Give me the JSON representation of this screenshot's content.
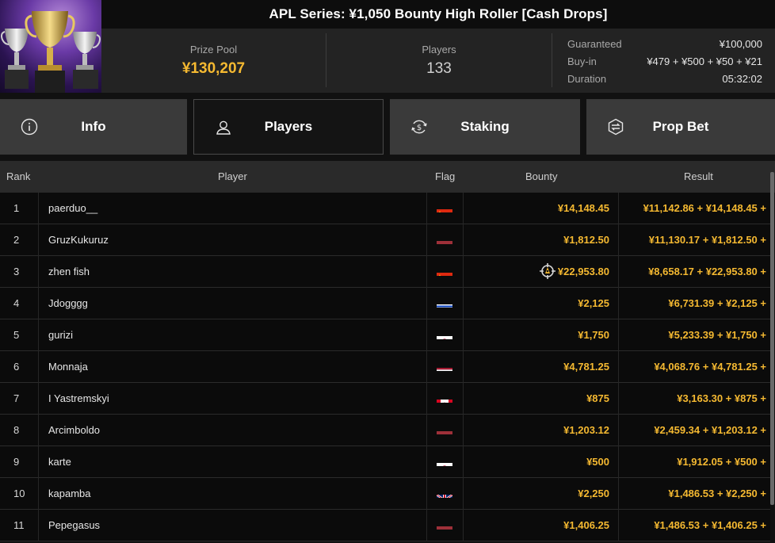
{
  "header": {
    "title": "APL Series: ¥1,050 Bounty High Roller [Cash Drops]",
    "prize_pool_label": "Prize Pool",
    "prize_pool_value": "¥130,207",
    "players_label": "Players",
    "players_value": "133",
    "details": [
      {
        "key": "Guaranteed",
        "value": "¥100,000"
      },
      {
        "key": "Buy-in",
        "value": "¥479 + ¥500 + ¥50 + ¥21"
      },
      {
        "key": "Duration",
        "value": "05:32:02"
      }
    ]
  },
  "tabs": [
    {
      "label": "Info",
      "icon": "info-icon",
      "active": false
    },
    {
      "label": "Players",
      "icon": "user-icon",
      "active": true
    },
    {
      "label": "Staking",
      "icon": "dollar-cycle-icon",
      "active": false
    },
    {
      "label": "Prop Bet",
      "icon": "prop-bet-icon",
      "active": false
    }
  ],
  "table": {
    "columns": {
      "rank": "Rank",
      "player": "Player",
      "flag": "Flag",
      "bounty": "Bounty",
      "result": "Result"
    },
    "rows": [
      {
        "rank": "1",
        "player": "paerduo__",
        "flag": "cn",
        "bounty": "¥14,148.45",
        "result": "¥11,142.86 + ¥14,148.45 +"
      },
      {
        "rank": "2",
        "player": "GruzKukuruz",
        "flag": "lv",
        "bounty": "¥1,812.50",
        "result": "¥11,130.17 + ¥1,812.50 +"
      },
      {
        "rank": "3",
        "player": "zhen fish",
        "flag": "cn",
        "bounty": "¥22,953.80",
        "result": "¥8,658.17 + ¥22,953.80 +",
        "bounty_icon": "target-icon"
      },
      {
        "rank": "4",
        "player": "Jdogggg",
        "flag": "il",
        "bounty": "¥2,125",
        "result": "¥6,731.39 + ¥2,125 +"
      },
      {
        "rank": "5",
        "player": "gurizi",
        "flag": "jp",
        "bounty": "¥1,750",
        "result": "¥5,233.39 + ¥1,750 +"
      },
      {
        "rank": "6",
        "player": "Monnaja",
        "flag": "th",
        "bounty": "¥4,781.25",
        "result": "¥4,068.76 + ¥4,781.25 +"
      },
      {
        "rank": "7",
        "player": "I Yastremskyi",
        "flag": "ca",
        "bounty": "¥875",
        "result": "¥3,163.30 + ¥875 +"
      },
      {
        "rank": "8",
        "player": "Arcimboldo",
        "flag": "lv",
        "bounty": "¥1,203.12",
        "result": "¥2,459.34 + ¥1,203.12 +"
      },
      {
        "rank": "9",
        "player": "karte",
        "flag": "jp",
        "bounty": "¥500",
        "result": "¥1,912.05 + ¥500 +"
      },
      {
        "rank": "10",
        "player": "kapamba",
        "flag": "gb",
        "bounty": "¥2,250",
        "result": "¥1,486.53 + ¥2,250 +"
      },
      {
        "rank": "11",
        "player": "Pepegasus",
        "flag": "lv",
        "bounty": "¥1,406.25",
        "result": "¥1,486.53 + ¥1,406.25 +"
      }
    ]
  },
  "colors": {
    "accent_gold": "#f5b931",
    "row_bg": "#0b0b0b",
    "header_bg": "#2a2a2a",
    "tab_bg": "#3a3a3a"
  }
}
